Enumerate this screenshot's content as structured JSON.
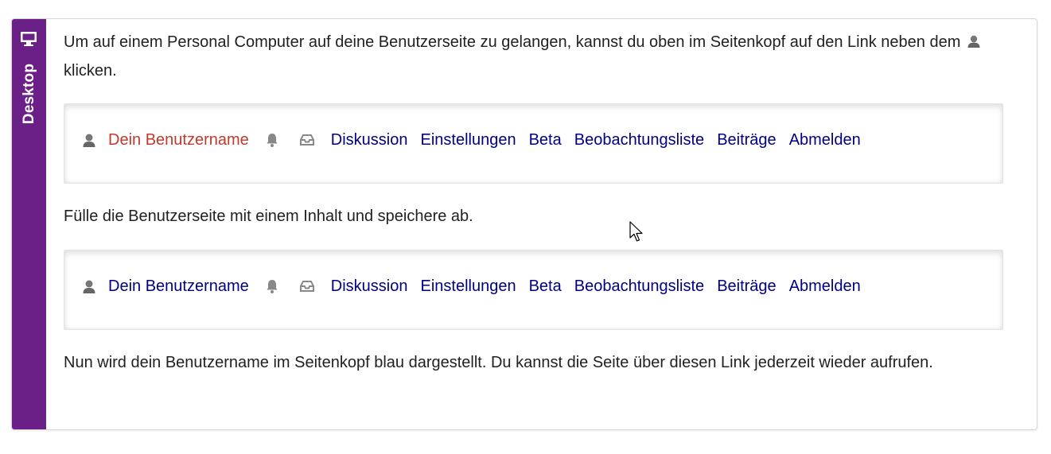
{
  "sidebar": {
    "label": "Desktop",
    "icon": "monitor-icon",
    "color": "#6b2088"
  },
  "paragraph1": {
    "before_icon": "Um auf einem Personal Computer auf deine Benutzerseite zu gelangen, kannst du oben im Seitenkopf auf den Link neben dem",
    "icon": "user-icon",
    "after_icon": "klicken."
  },
  "bar_red": {
    "username": "Dein Benutzername",
    "username_color": "#c0392b",
    "links": [
      "Diskussion",
      "Einstellungen",
      "Beta",
      "Beobachtungsliste",
      "Beiträge",
      "Abmelden"
    ]
  },
  "paragraph2": "Fülle die Benutzerseite mit einem Inhalt und speichere ab.",
  "bar_blue": {
    "username": "Dein Benutzername",
    "username_color": "#000080",
    "links": [
      "Diskussion",
      "Einstellungen",
      "Beta",
      "Beobachtungsliste",
      "Beiträge",
      "Abmelden"
    ]
  },
  "paragraph3": "Nun wird dein Benutzername im Seitenkopf blau dargestellt. Du kannst die Seite über diesen Link jederzeit wieder aufrufen."
}
